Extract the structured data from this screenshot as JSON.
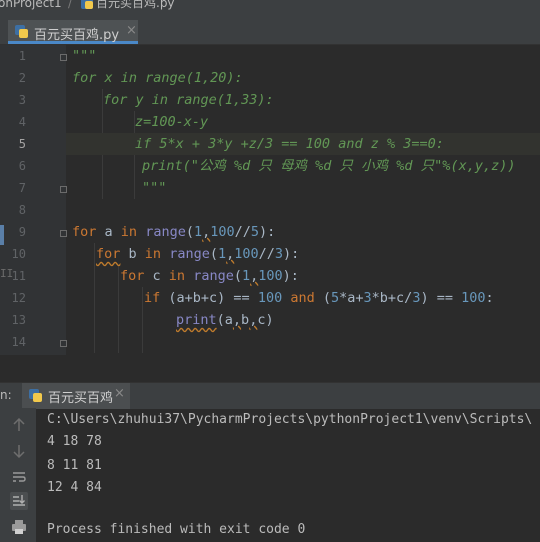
{
  "breadcrumb": {
    "project": "onProject1",
    "separator": "/",
    "file": "百元买百鸡.py"
  },
  "editor_tab": {
    "label": "百元买百鸡.py",
    "close": "×",
    "icon": "python-file-icon"
  },
  "line_numbers": [
    "1",
    "2",
    "3",
    "4",
    "5",
    "6",
    "7",
    "8",
    "9",
    "10",
    "11",
    "12",
    "13",
    "14"
  ],
  "active_line": 5,
  "code": {
    "l1_t1": "\"\"\"",
    "l2_t1": "for x in range(1,20):",
    "l3_t1": "for y in range(1,33):",
    "l4_t1": "z=100-x-y",
    "l5_t1": "if 5*x + 3*y +z/3 == 100 and z % 3==0:",
    "l6_t1": "print(\"公鸡 %d 只 母鸡 %d 只 小鸡 %d 只\"%(x,y,z))",
    "l7_t1": "\"\"\"",
    "l9": [
      "for",
      " a ",
      "in",
      " ",
      "range",
      "(",
      "1",
      ",",
      "100",
      "//",
      "5",
      "):"
    ],
    "l10": [
      "for",
      " b ",
      "in",
      " ",
      "range",
      "(",
      "1",
      ",",
      "100",
      "//",
      "3",
      "):"
    ],
    "l11": [
      "for",
      " c ",
      "in",
      " ",
      "range",
      "(",
      "1",
      ",",
      "100",
      "):"
    ],
    "l12": [
      "if",
      " (a+b+c) == ",
      "100",
      " ",
      "and",
      " (",
      "5",
      "*a+",
      "3",
      "*b+c/",
      "3",
      ") == ",
      "100",
      ":"
    ],
    "l13": [
      "print",
      "(a",
      ",",
      "b",
      ",",
      "c)"
    ]
  },
  "run_panel": {
    "label": "n:",
    "tab_label": "百元买百鸡",
    "close": "×",
    "command": "C:\\Users\\zhuhui37\\PycharmProjects\\pythonProject1\\venv\\Scripts\\",
    "output": [
      "4 18 78",
      "8 11 81",
      "12 4 84"
    ],
    "exit_message": "Process finished with exit code 0"
  },
  "colors": {
    "background": "#2b2b2b",
    "keyword": "#cc7832",
    "builtin": "#8888c6",
    "number": "#6897bb",
    "comment": "#629755",
    "text": "#a9b7c6"
  }
}
